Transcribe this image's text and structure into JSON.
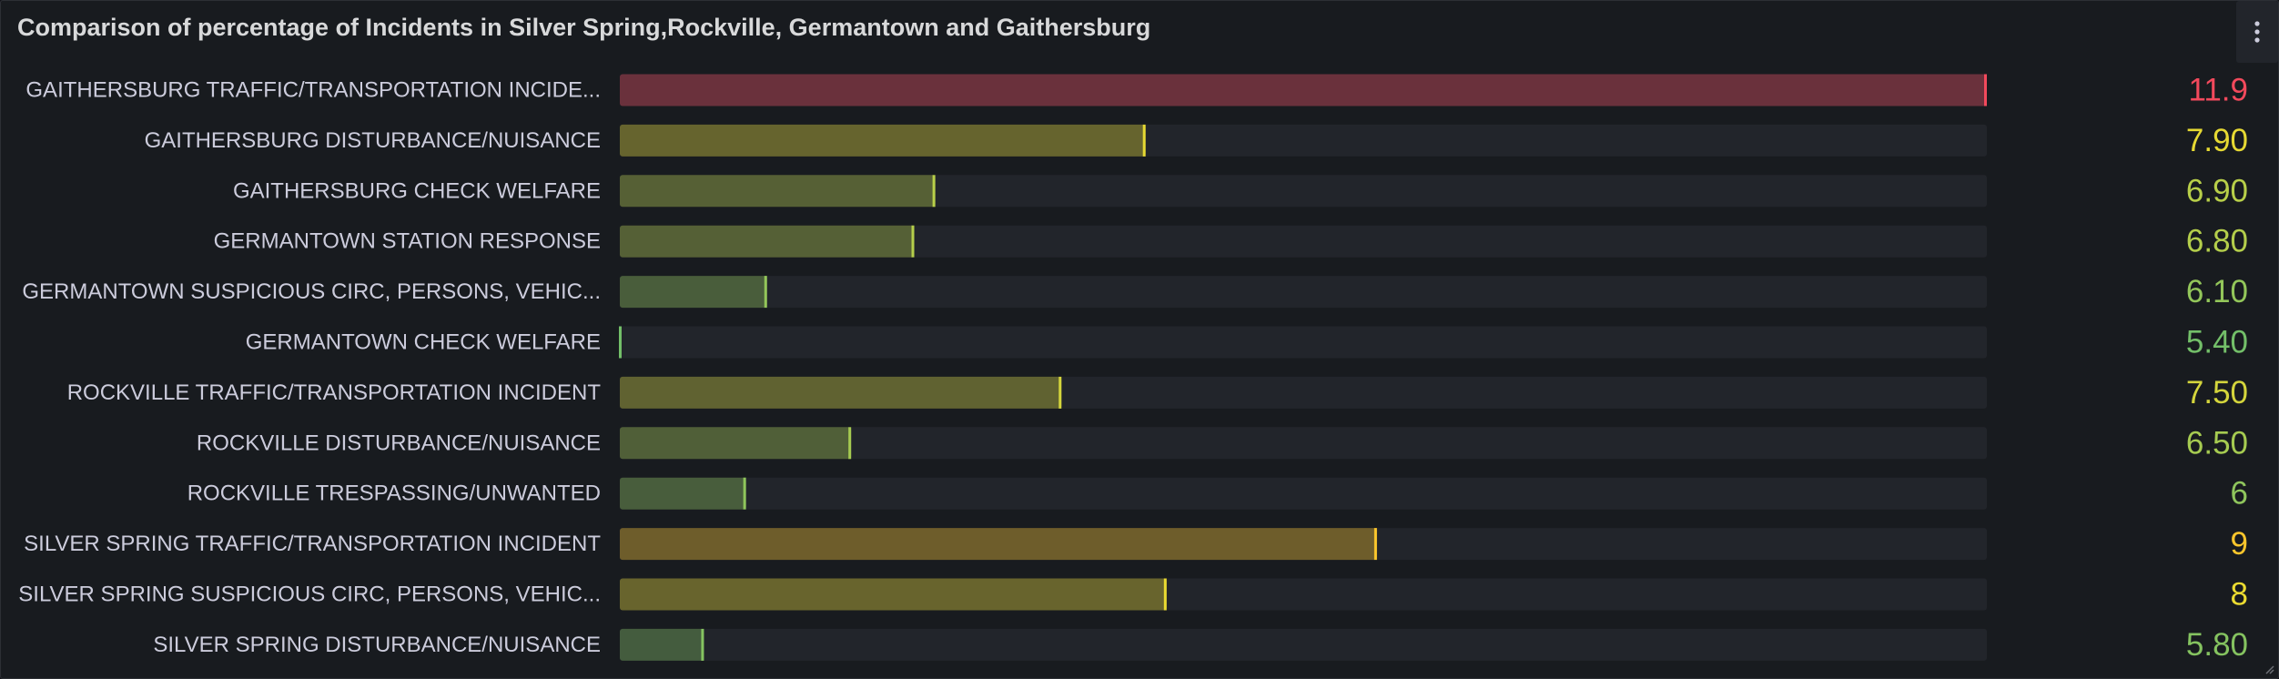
{
  "panel": {
    "title": "Comparison of percentage of Incidents in Silver Spring,Rockville, Germantown and Gaithersburg",
    "menu_icon": "vertical-ellipsis-icon",
    "resize_icon": "resize-corner-icon"
  },
  "chart_data": {
    "type": "bar",
    "orientation": "horizontal",
    "display_mode": "gradient-gauge",
    "title": "Comparison of percentage of Incidents in Silver Spring,Rockville, Germantown and Gaithersburg",
    "xlim": [
      5.4,
      11.9
    ],
    "categories": [
      "GAITHERSBURG TRAFFIC/TRANSPORTATION INCIDE...",
      "GAITHERSBURG DISTURBANCE/NUISANCE",
      "GAITHERSBURG CHECK WELFARE",
      "GERMANTOWN STATION RESPONSE",
      "GERMANTOWN SUSPICIOUS CIRC, PERSONS, VEHIC...",
      "GERMANTOWN CHECK WELFARE",
      "ROCKVILLE TRAFFIC/TRANSPORTATION INCIDENT",
      "ROCKVILLE DISTURBANCE/NUISANCE",
      "ROCKVILLE TRESPASSING/UNWANTED",
      "SILVER SPRING TRAFFIC/TRANSPORTATION INCIDENT",
      "SILVER SPRING SUSPICIOUS CIRC, PERSONS, VEHIC...",
      "SILVER SPRING DISTURBANCE/NUISANCE"
    ],
    "values": [
      11.9,
      7.9,
      6.9,
      6.8,
      6.1,
      5.4,
      7.5,
      6.5,
      6,
      9,
      8,
      5.8
    ],
    "value_labels": [
      "11.9",
      "7.90",
      "6.90",
      "6.80",
      "6.10",
      "5.40",
      "7.50",
      "6.50",
      "6",
      "9",
      "8",
      "5.80"
    ],
    "colors": {
      "track": "#22252b",
      "low": "#73bf69",
      "mid": "#fade2a",
      "high": "#ff9830",
      "max": "#f2495c"
    }
  }
}
